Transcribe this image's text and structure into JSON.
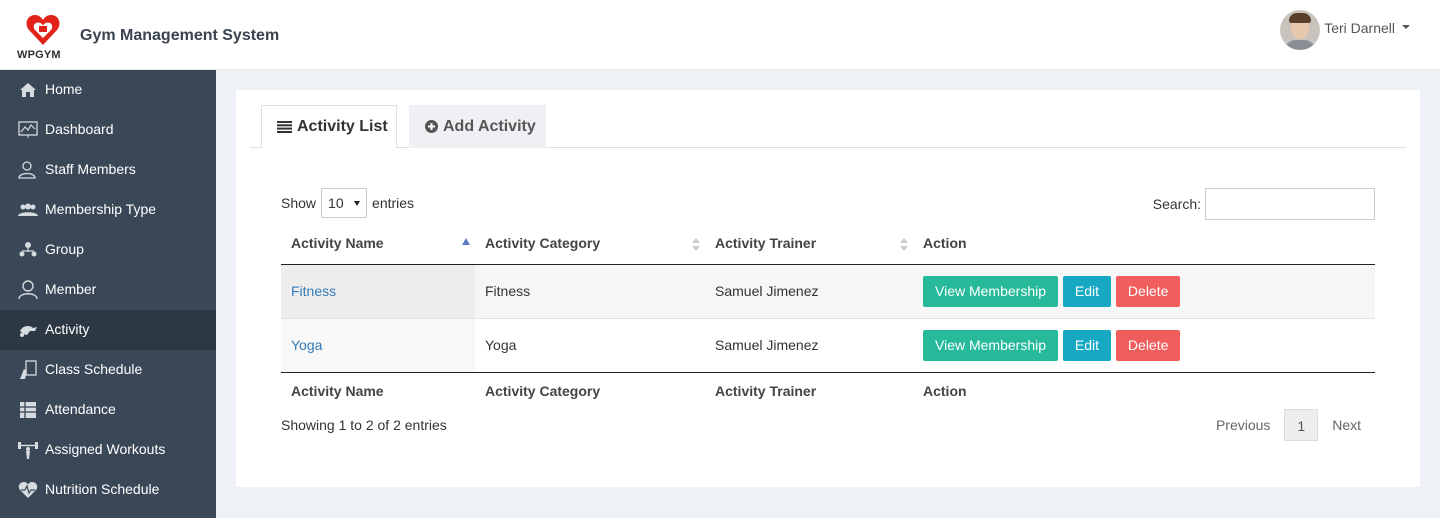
{
  "header": {
    "logo_text": "WPGYM",
    "app_title": "Gym Management System",
    "user_name": "Teri Darnell"
  },
  "sidebar": {
    "items": [
      {
        "label": "Home",
        "icon": "home-icon"
      },
      {
        "label": "Dashboard",
        "icon": "dashboard-icon"
      },
      {
        "label": "Staff Members",
        "icon": "staff-icon"
      },
      {
        "label": "Membership Type",
        "icon": "membership-icon"
      },
      {
        "label": "Group",
        "icon": "group-icon"
      },
      {
        "label": "Member",
        "icon": "member-icon"
      },
      {
        "label": "Activity",
        "icon": "activity-icon",
        "active": true
      },
      {
        "label": "Class Schedule",
        "icon": "class-schedule-icon"
      },
      {
        "label": "Attendance",
        "icon": "attendance-icon"
      },
      {
        "label": "Assigned Workouts",
        "icon": "workout-icon"
      },
      {
        "label": "Nutrition Schedule",
        "icon": "nutrition-icon"
      }
    ]
  },
  "tabs": {
    "activity_list": "Activity List",
    "add_activity": "Add Activity"
  },
  "table_controls": {
    "show_label": "Show",
    "entries_value": "10",
    "entries_label": "entries",
    "search_label": "Search:",
    "search_value": ""
  },
  "table": {
    "columns": [
      "Activity Name",
      "Activity Category",
      "Activity Trainer",
      "Action"
    ],
    "rows": [
      {
        "name": "Fitness",
        "category": "Fitness",
        "trainer": "Samuel Jimenez"
      },
      {
        "name": "Yoga",
        "category": "Yoga",
        "trainer": "Samuel Jimenez"
      }
    ],
    "actions": {
      "view": "View Membership",
      "edit": "Edit",
      "delete": "Delete"
    }
  },
  "footer": {
    "info": "Showing 1 to 2 of 2 entries",
    "previous": "Previous",
    "page": "1",
    "next": "Next"
  },
  "colors": {
    "sidebar": "#3a4756",
    "view_button": "#26b99a",
    "edit_button": "#17a8c4",
    "delete_button": "#f05d5d",
    "link": "#337ab7"
  }
}
